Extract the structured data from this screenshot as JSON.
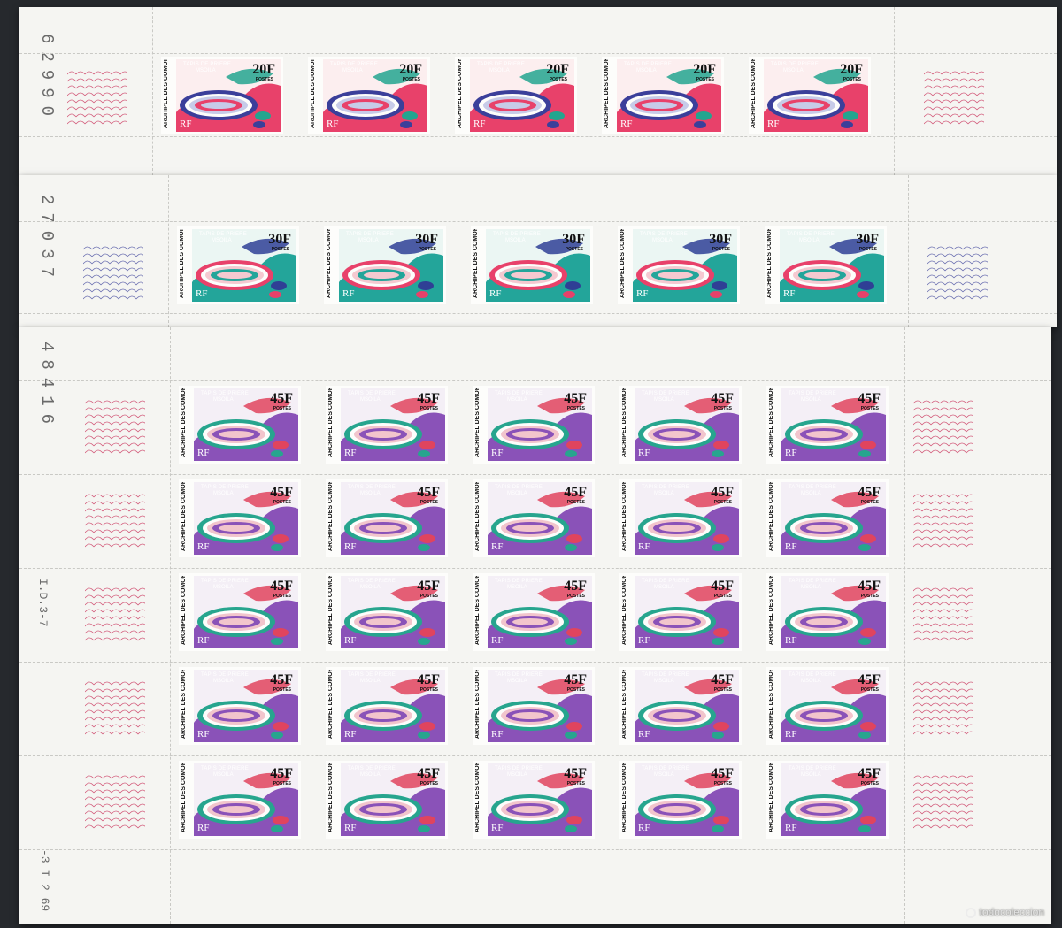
{
  "stamp_common": {
    "title": "TAPIS DE PRIERE",
    "subtitle": "MSOILA",
    "postes": "POSTES",
    "country": "ARCHIPEL DES COMORES",
    "rf": "RF"
  },
  "sheets": [
    {
      "sheet_number": "62990",
      "value": "20F",
      "colors": {
        "bg": "#e8416a",
        "accent": "#23a58f",
        "mat_outer": "#3b3f9a",
        "mat_inner": "#c7cbe8",
        "mat_core": "#e8416a"
      },
      "rows": 1,
      "cols": 5
    },
    {
      "sheet_number": "27037",
      "value": "30F",
      "colors": {
        "bg": "#23a59a",
        "accent": "#2f3f95",
        "mat_outer": "#e8416a",
        "mat_inner": "#f5c9d0",
        "mat_core": "#23a59a"
      },
      "rows": 1,
      "cols": 5
    },
    {
      "sheet_number": "48416",
      "value": "45F",
      "print_date": "-3 I 2 69",
      "press_code": "I.D.3-7",
      "colors": {
        "bg": "#8a52b8",
        "accent": "#e0445e",
        "mat_outer": "#27a58e",
        "mat_inner": "#f2c5cc",
        "mat_core": "#8a52b8"
      },
      "rows": 5,
      "cols": 5
    }
  ],
  "watermark": "todocoleccion"
}
